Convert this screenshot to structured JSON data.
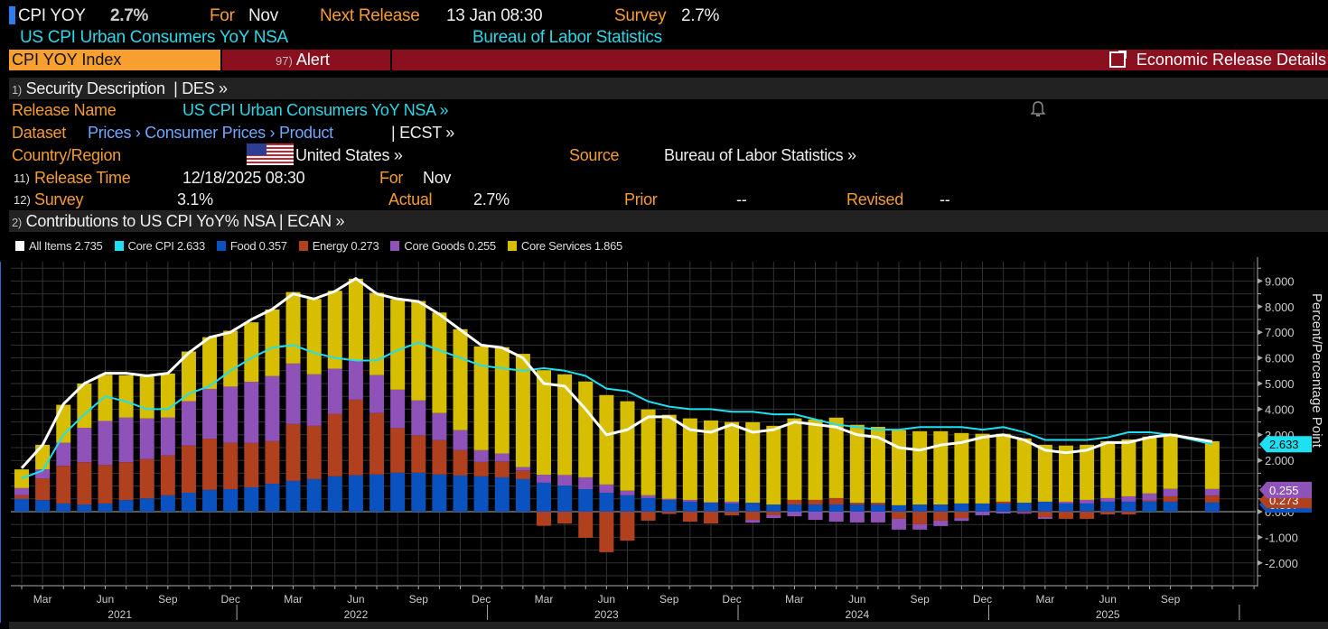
{
  "header": {
    "ticker": "CPI YOY",
    "value": "2.7%",
    "for_label": "For",
    "for_value": "Nov",
    "next_release_label": "Next Release",
    "next_release_value": "13 Jan 08:30",
    "survey_label": "Survey",
    "survey_value": "2.7%",
    "subtitle": "US CPI Urban Consumers YoY NSA",
    "source": "Bureau of Labor Statistics"
  },
  "toolbar": {
    "security": "CPI YOY Index",
    "alert_num": "97)",
    "alert": "Alert",
    "details": "Economic Release Details"
  },
  "section1": {
    "num": "1)",
    "title": "Security Description",
    "code": "| DES »"
  },
  "fields": {
    "release_name_label": "Release Name",
    "release_name": "US CPI Urban Consumers YoY NSA »",
    "dataset_label": "Dataset",
    "dataset_path": "Prices › Consumer Prices › Product",
    "dataset_code": "| ECST »",
    "country_label": "Country/Region",
    "country": "United States »",
    "source_label": "Source",
    "source": "Bureau of Labor Statistics »",
    "release_time_num": "11)",
    "release_time_label": "Release Time",
    "release_time": "12/18/2025 08:30",
    "for_label": "For",
    "for_value": "Nov",
    "survey_num": "12)",
    "survey_label": "Survey",
    "survey": "3.1%",
    "actual_label": "Actual",
    "actual": "2.7%",
    "prior_label": "Prior",
    "prior": "--",
    "revised_label": "Revised",
    "revised": "--"
  },
  "section2": {
    "num": "2)",
    "title": "Contributions to US CPI YoY% NSA | ECAN »"
  },
  "chart_data": {
    "type": "bar",
    "stacked": true,
    "ylabel": "Percent/Percentage Point",
    "ylim": [
      -2.8,
      9.8
    ],
    "yticks": [
      "-2.000",
      "-1.000",
      "0.000",
      "2.000",
      "3.000",
      "4.000",
      "5.000",
      "6.000",
      "7.000",
      "8.000",
      "9.000"
    ],
    "ytick_values": [
      -2,
      -1,
      0,
      2,
      3,
      4,
      5,
      6,
      7,
      8,
      9
    ],
    "x_start": "Feb 2021",
    "x_end": "Nov 2025",
    "x_ticks": [
      {
        "i": 1,
        "label": "Mar"
      },
      {
        "i": 4,
        "label": "Jun"
      },
      {
        "i": 7,
        "label": "Sep"
      },
      {
        "i": 10,
        "label": "Dec"
      },
      {
        "i": 13,
        "label": "Mar"
      },
      {
        "i": 16,
        "label": "Jun"
      },
      {
        "i": 19,
        "label": "Sep"
      },
      {
        "i": 22,
        "label": "Dec"
      },
      {
        "i": 25,
        "label": "Mar"
      },
      {
        "i": 28,
        "label": "Jun"
      },
      {
        "i": 31,
        "label": "Sep"
      },
      {
        "i": 34,
        "label": "Dec"
      },
      {
        "i": 37,
        "label": "Mar"
      },
      {
        "i": 40,
        "label": "Jun"
      },
      {
        "i": 43,
        "label": "Sep"
      },
      {
        "i": 46,
        "label": "Dec"
      },
      {
        "i": 49,
        "label": "Mar"
      },
      {
        "i": 52,
        "label": "Jun"
      },
      {
        "i": 55,
        "label": "Sep"
      }
    ],
    "years": [
      {
        "i": 4.7,
        "label": "2021"
      },
      {
        "i": 16,
        "label": "2022"
      },
      {
        "i": 28,
        "label": "2023"
      },
      {
        "i": 40,
        "label": "2024"
      },
      {
        "i": 52,
        "label": "2025"
      }
    ],
    "legend": [
      {
        "name": "All Items",
        "value": "2.735",
        "color": "#ffffff"
      },
      {
        "name": "Core CPI",
        "value": "2.633",
        "color": "#1de0f0"
      },
      {
        "name": "Food",
        "value": "0.357",
        "color": "#0a52c0"
      },
      {
        "name": "Energy",
        "value": "0.273",
        "color": "#b0401e"
      },
      {
        "name": "Core Goods",
        "value": "0.255",
        "color": "#8e52b8"
      },
      {
        "name": "Core Services",
        "value": "1.865",
        "color": "#d8be00"
      }
    ],
    "tags": {
      "core": "2.633",
      "goods": "0.255",
      "energy": "0.273",
      "food": "0.357"
    },
    "series": [
      {
        "name": "Food",
        "values": [
          0.5,
          0.45,
          0.32,
          0.28,
          0.32,
          0.45,
          0.52,
          0.64,
          0.74,
          0.85,
          0.88,
          0.95,
          1.09,
          1.2,
          1.27,
          1.38,
          1.42,
          1.45,
          1.52,
          1.52,
          1.45,
          1.41,
          1.38,
          1.34,
          1.27,
          1.13,
          1.02,
          0.88,
          0.74,
          0.64,
          0.53,
          0.46,
          0.39,
          0.35,
          0.32,
          0.35,
          0.28,
          0.28,
          0.28,
          0.28,
          0.28,
          0.28,
          0.25,
          0.28,
          0.28,
          0.32,
          0.32,
          0.32,
          0.35,
          0.39,
          0.32,
          0.32,
          0.39,
          0.39,
          0.39,
          0.39,
          null,
          0.357
        ]
      },
      {
        "name": "Energy",
        "values": [
          0.14,
          0.85,
          1.47,
          1.65,
          1.5,
          1.48,
          1.53,
          1.55,
          1.84,
          2.0,
          1.81,
          1.73,
          1.66,
          2.22,
          2.08,
          2.44,
          2.95,
          2.4,
          1.74,
          1.46,
          1.34,
          0.99,
          0.56,
          0.62,
          0.34,
          -0.55,
          -0.46,
          -1.02,
          -1.58,
          -1.13,
          -0.35,
          -0.09,
          -0.39,
          -0.46,
          -0.14,
          -0.32,
          -0.14,
          0.18,
          0.18,
          0.25,
          0.07,
          0.07,
          -0.28,
          -0.49,
          -0.35,
          -0.25,
          0,
          0.07,
          -0.04,
          -0.21,
          -0.28,
          -0.28,
          -0.11,
          -0.11,
          0.04,
          0.21,
          null,
          0.273
        ]
      },
      {
        "name": "Core Goods",
        "values": [
          0.28,
          0.35,
          0.9,
          1.34,
          1.72,
          1.74,
          1.59,
          1.48,
          1.73,
          1.94,
          2.19,
          2.39,
          2.54,
          2.36,
          2.01,
          1.76,
          1.52,
          1.48,
          1.5,
          1.36,
          1.06,
          0.78,
          0.46,
          0.31,
          0.13,
          0.31,
          0.41,
          0.46,
          0.32,
          0.18,
          0.11,
          0.04,
          0.07,
          0.02,
          0.07,
          -0.11,
          -0.11,
          -0.18,
          -0.32,
          -0.39,
          -0.42,
          -0.42,
          -0.42,
          -0.21,
          -0.21,
          -0.11,
          -0.14,
          -0.07,
          -0.04,
          -0.07,
          0.07,
          0.14,
          0.14,
          0.21,
          0.28,
          0.29,
          null,
          0.255
        ]
      },
      {
        "name": "Core Services",
        "values": [
          0.73,
          0.96,
          1.48,
          1.73,
          1.8,
          1.65,
          1.7,
          1.72,
          1.94,
          2.02,
          2.18,
          2.32,
          2.6,
          2.79,
          2.94,
          3.04,
          3.2,
          3.21,
          3.53,
          3.88,
          3.92,
          3.94,
          4.05,
          4.15,
          4.42,
          4.08,
          3.93,
          3.74,
          3.49,
          3.49,
          3.35,
          3.28,
          3.18,
          3.19,
          3.11,
          3.14,
          3.07,
          3.18,
          3.14,
          3.14,
          3.04,
          2.96,
          2.93,
          2.86,
          2.86,
          2.75,
          2.72,
          2.65,
          2.51,
          2.22,
          2.19,
          2.15,
          2.22,
          2.22,
          2.22,
          2.15,
          null,
          1.865
        ]
      },
      {
        "name": "All Items",
        "type": "line",
        "values": [
          1.7,
          2.6,
          4.2,
          5.0,
          5.4,
          5.4,
          5.3,
          5.4,
          6.2,
          6.8,
          7.0,
          7.5,
          7.9,
          8.5,
          8.3,
          8.6,
          9.1,
          8.5,
          8.3,
          8.2,
          7.7,
          7.1,
          6.5,
          6.4,
          6.0,
          5.0,
          4.9,
          4.0,
          3.0,
          3.2,
          3.7,
          3.7,
          3.2,
          3.1,
          3.4,
          3.1,
          3.2,
          3.5,
          3.4,
          3.3,
          3.0,
          2.9,
          2.5,
          2.4,
          2.6,
          2.7,
          2.9,
          3.0,
          2.8,
          2.4,
          2.3,
          2.4,
          2.7,
          2.7,
          2.9,
          3.0,
          null,
          2.735
        ]
      },
      {
        "name": "Core CPI",
        "type": "line",
        "values": [
          1.3,
          1.6,
          3.0,
          3.8,
          4.5,
          4.3,
          4.0,
          4.0,
          4.6,
          4.9,
          5.5,
          6.0,
          6.4,
          6.5,
          6.2,
          6.0,
          5.9,
          5.9,
          6.3,
          6.6,
          6.3,
          6.0,
          5.7,
          5.6,
          5.5,
          5.6,
          5.5,
          5.3,
          4.8,
          4.7,
          4.3,
          4.1,
          4.0,
          4.0,
          3.9,
          3.9,
          3.8,
          3.8,
          3.6,
          3.4,
          3.3,
          3.2,
          3.2,
          3.3,
          3.3,
          3.3,
          3.2,
          3.3,
          3.1,
          2.8,
          2.8,
          2.8,
          2.9,
          3.1,
          3.1,
          3.0,
          null,
          2.633
        ]
      }
    ]
  }
}
